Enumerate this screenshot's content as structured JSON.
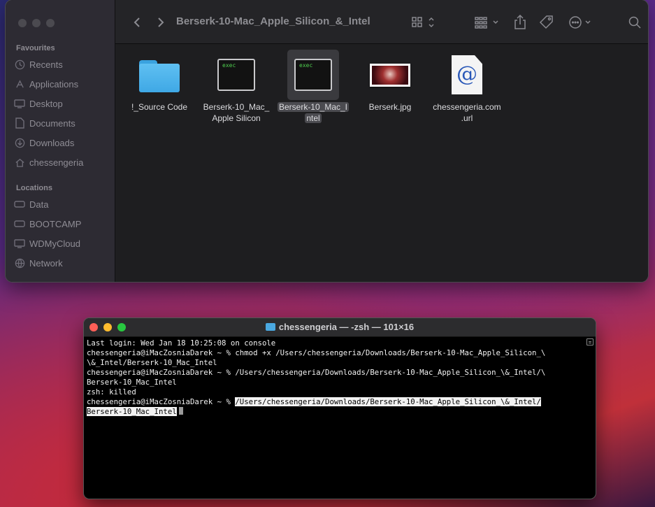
{
  "finder": {
    "title": "Berserk-10-Mac_Apple_Silicon_&_Intel",
    "sidebar": {
      "favourites_header": "Favourites",
      "favourites": [
        {
          "label": "Recents",
          "icon": "clock-icon"
        },
        {
          "label": "Applications",
          "icon": "applications-icon"
        },
        {
          "label": "Desktop",
          "icon": "desktop-icon"
        },
        {
          "label": "Documents",
          "icon": "document-icon"
        },
        {
          "label": "Downloads",
          "icon": "download-icon"
        },
        {
          "label": "chessengeria",
          "icon": "home-icon"
        }
      ],
      "locations_header": "Locations",
      "locations": [
        {
          "label": "Data",
          "icon": "drive-icon"
        },
        {
          "label": "BOOTCAMP",
          "icon": "drive-icon"
        },
        {
          "label": "WDMyCloud",
          "icon": "display-icon"
        },
        {
          "label": "Network",
          "icon": "globe-icon"
        }
      ]
    },
    "files": [
      {
        "name_line1": "!_Source Code",
        "name_line2": "",
        "type": "folder"
      },
      {
        "name_line1": "Berserk-10_Mac_",
        "name_line2": "Apple Silicon",
        "type": "exec",
        "icon_text": "exec"
      },
      {
        "name_line1": "Berserk-10_Mac_I",
        "name_line2": "ntel",
        "type": "exec",
        "icon_text": "exec",
        "selected": true
      },
      {
        "name_line1": "Berserk.jpg",
        "name_line2": "",
        "type": "image"
      },
      {
        "name_line1": "chessengeria.com",
        "name_line2": ".url",
        "type": "url",
        "icon_text": "@"
      }
    ]
  },
  "terminal": {
    "title": "chessengeria — -zsh — 101×16",
    "lines": [
      "Last login: Wed Jan 18 10:25:08 on console",
      "chessengeria@iMacZosniaDarek ~ % chmod +x /Users/chessengeria/Downloads/Berserk-10-Mac_Apple_Silicon_\\",
      "\\&_Intel/Berserk-10_Mac_Intel",
      "chessengeria@iMacZosniaDarek ~ % /Users/chessengeria/Downloads/Berserk-10-Mac_Apple_Silicon_\\&_Intel/\\",
      "Berserk-10_Mac_Intel",
      "zsh: killed",
      "chessengeria@iMacZosniaDarek ~ % "
    ],
    "selected_line1": "/Users/chessengeria/Downloads/Berserk-10-Mac_Apple_Silicon_\\&_Intel/",
    "selected_line2": "Berserk-10_Mac_Intel"
  }
}
